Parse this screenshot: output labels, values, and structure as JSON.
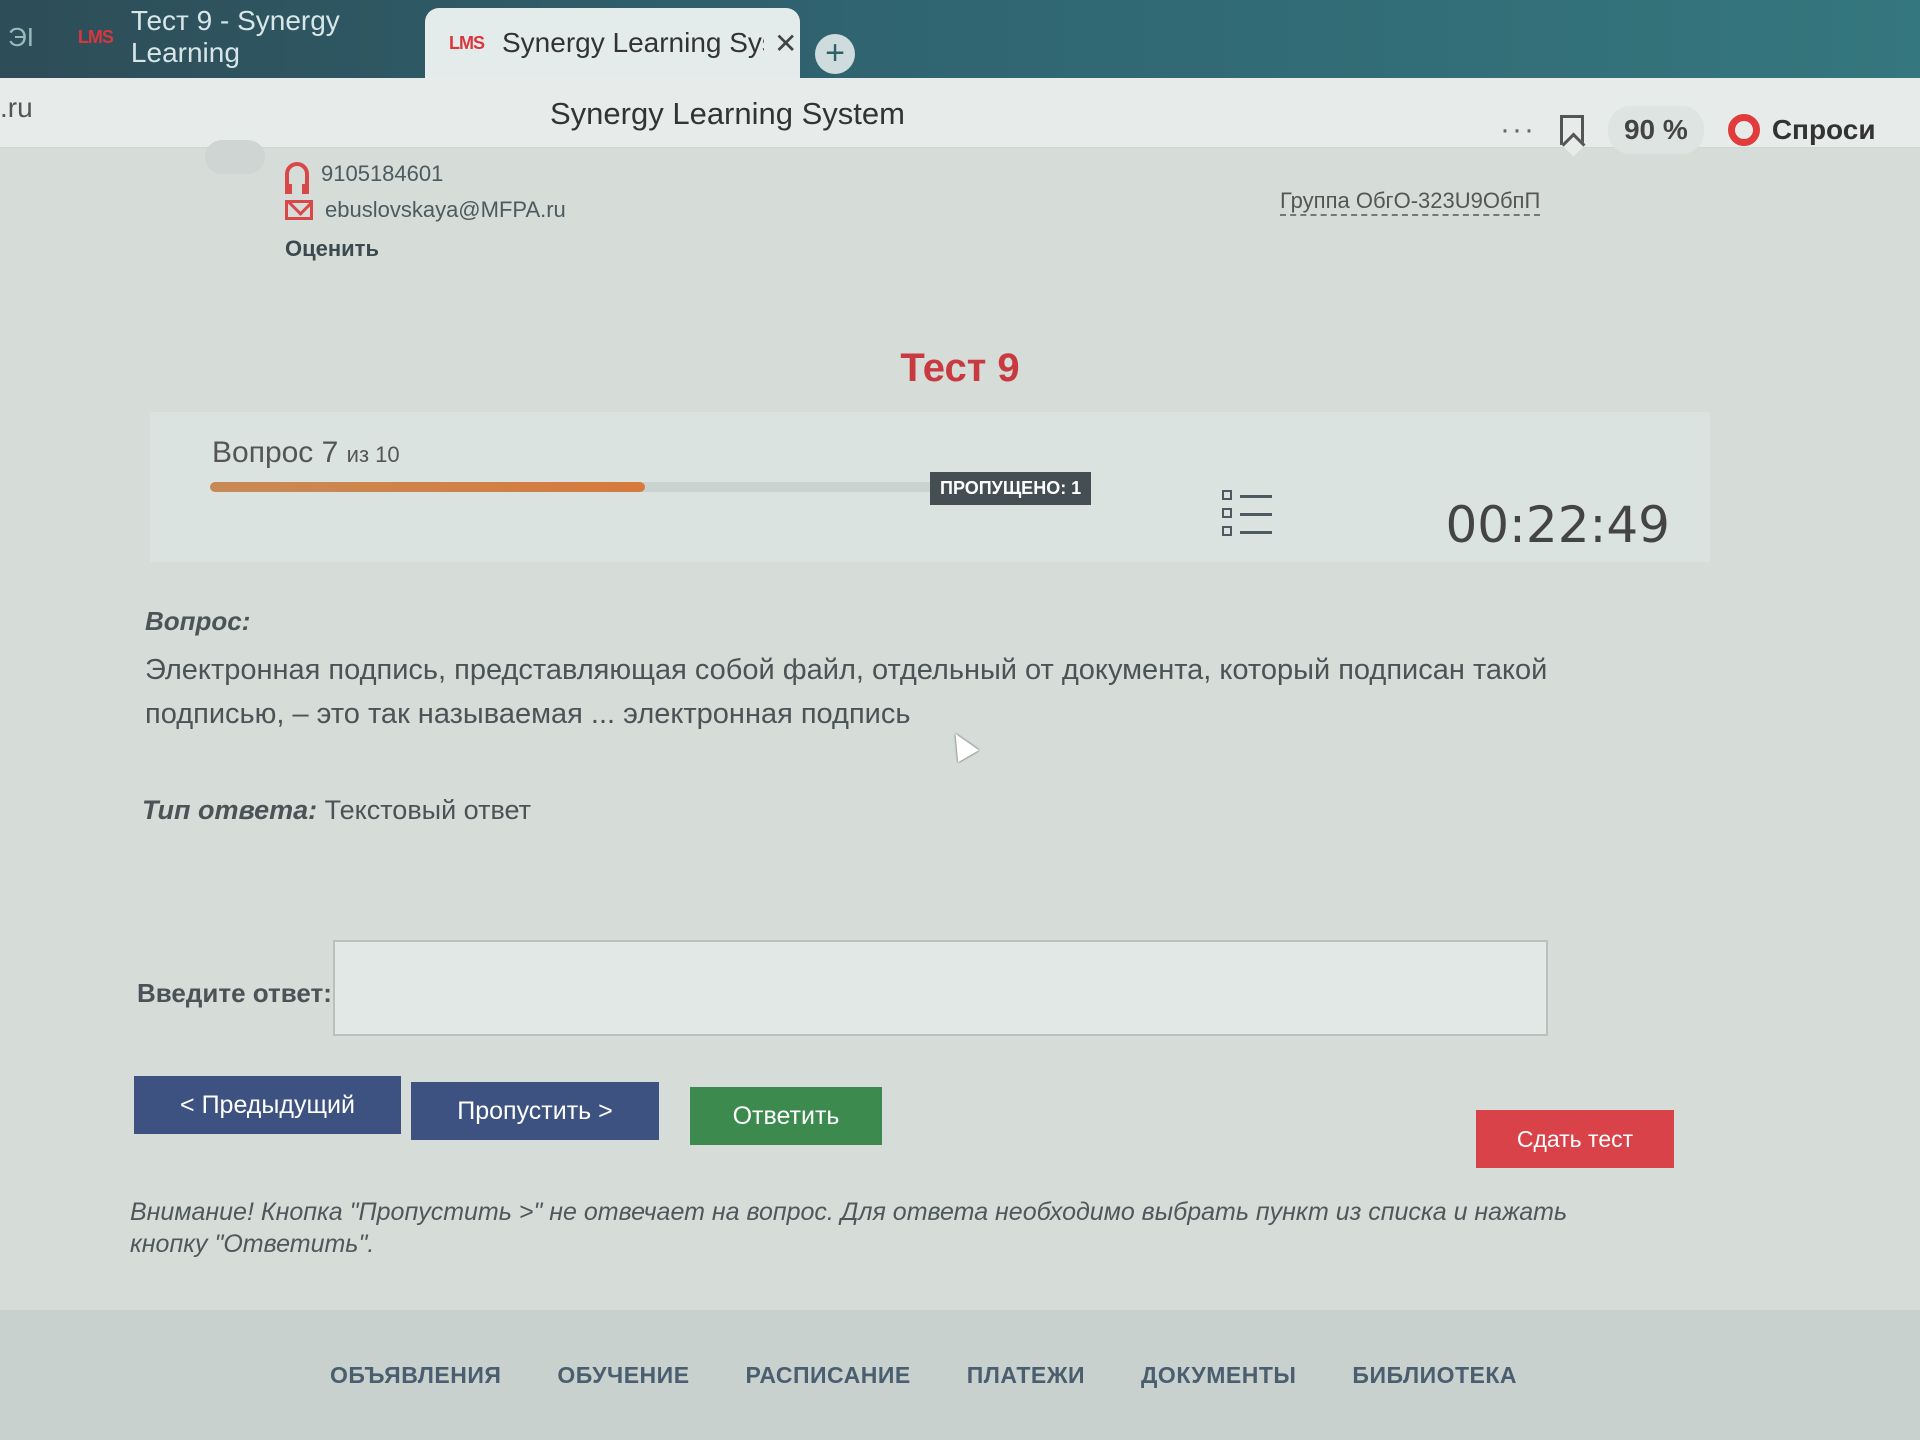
{
  "browser": {
    "tabs": [
      {
        "label": "Тест 9 - Synergy Learning",
        "badge": "LMS",
        "active": false
      },
      {
        "label": "Synergy Learning System",
        "badge": "LMS",
        "active": true
      }
    ],
    "new_tab_label": "+",
    "close_label": "✕",
    "url_fragment": ".ru",
    "page_title": "Synergy Learning System",
    "menu_dots": "···",
    "zoom": "90 %",
    "ask_label": "Спроси"
  },
  "header": {
    "phone": "9105184601",
    "email": "ebuslovskaya@MFPA.ru",
    "rate_link": "Оценить",
    "group_label": "Группа ОбгО-323U9ОбпП"
  },
  "test": {
    "title": "Тест 9",
    "question_prefix": "Вопрос 7",
    "question_suffix": "из 10",
    "progress": 0.5,
    "skipped_badge": "ПРОПУЩЕНО: 1",
    "timer": "00:22:49",
    "question_heading": "Вопрос:",
    "question_text": "Электронная подпись, представляющая собой файл, отдельный от документа, который подписан такой подписью, – это так называемая ... электронная подпись",
    "answer_type_label": "Тип ответа:",
    "answer_type_value": "Текстовый ответ",
    "answer_label": "Введите ответ:",
    "answer_value": ""
  },
  "buttons": {
    "prev": "< Предыдущий",
    "skip": "Пропустить >",
    "answer": "Ответить",
    "submit": "Сдать тест"
  },
  "warning": "Внимание! Кнопка \"Пропустить >\" не отвечает на вопрос. Для ответа необходимо выбрать пункт из списка и нажать кнопку \"Ответить\".",
  "footer_nav": [
    "ОБЪЯВЛЕНИЯ",
    "ОБУЧЕНИЕ",
    "РАСПИСАНИЕ",
    "ПЛАТЕЖИ",
    "ДОКУМЕНТЫ",
    "БИБЛИОТЕКА"
  ],
  "colors": {
    "accent_red": "#c83a40",
    "nav_button": "#3e5282",
    "answer_button": "#3d8a4f",
    "submit_button": "#d94248"
  }
}
